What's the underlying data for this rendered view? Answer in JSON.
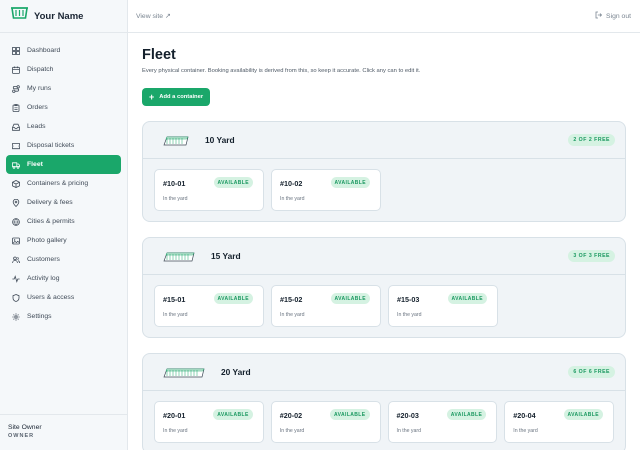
{
  "brand": {
    "name": "Your Name"
  },
  "topbar": {
    "view_site": "View site ↗",
    "sign_out": "Sign out"
  },
  "sidebar": {
    "items": [
      {
        "label": "Dashboard",
        "icon": "dashboard-icon"
      },
      {
        "label": "Dispatch",
        "icon": "calendar-icon"
      },
      {
        "label": "My runs",
        "icon": "route-icon"
      },
      {
        "label": "Orders",
        "icon": "clipboard-icon"
      },
      {
        "label": "Leads",
        "icon": "inbox-icon"
      },
      {
        "label": "Disposal tickets",
        "icon": "ticket-icon"
      },
      {
        "label": "Fleet",
        "icon": "truck-icon",
        "active": true
      },
      {
        "label": "Containers & pricing",
        "icon": "box-icon"
      },
      {
        "label": "Delivery & fees",
        "icon": "map-pin-icon"
      },
      {
        "label": "Cities & permits",
        "icon": "globe-icon"
      },
      {
        "label": "Photo gallery",
        "icon": "image-icon"
      },
      {
        "label": "Customers",
        "icon": "users-icon"
      },
      {
        "label": "Activity log",
        "icon": "activity-icon"
      },
      {
        "label": "Users & access",
        "icon": "shield-icon"
      },
      {
        "label": "Settings",
        "icon": "gear-icon"
      }
    ],
    "footer": {
      "name": "Site Owner",
      "role": "OWNER"
    }
  },
  "page": {
    "title": "Fleet",
    "subtitle": "Every physical container. Booking availability is derived from this, so keep it accurate. Click any can to edit it.",
    "add_button": "Add a container"
  },
  "groups": [
    {
      "title": "10 Yard",
      "free": "2 OF 2 FREE",
      "containers": [
        {
          "id": "#10-01",
          "status": "AVAILABLE",
          "location": "In the yard"
        },
        {
          "id": "#10-02",
          "status": "AVAILABLE",
          "location": "In the yard"
        }
      ]
    },
    {
      "title": "15 Yard",
      "free": "3 OF 3 FREE",
      "containers": [
        {
          "id": "#15-01",
          "status": "AVAILABLE",
          "location": "In the yard"
        },
        {
          "id": "#15-02",
          "status": "AVAILABLE",
          "location": "In the yard"
        },
        {
          "id": "#15-03",
          "status": "AVAILABLE",
          "location": "In the yard"
        }
      ]
    },
    {
      "title": "20 Yard",
      "free": "6 OF 6 FREE",
      "containers": [
        {
          "id": "#20-01",
          "status": "AVAILABLE",
          "location": "In the yard"
        },
        {
          "id": "#20-02",
          "status": "AVAILABLE",
          "location": "In the yard"
        },
        {
          "id": "#20-03",
          "status": "AVAILABLE",
          "location": "In the yard"
        },
        {
          "id": "#20-04",
          "status": "AVAILABLE",
          "location": "In the yard"
        }
      ]
    }
  ],
  "colors": {
    "accent": "#1aa76a",
    "badge_bg": "#d5f2e2",
    "badge_text": "#19985f"
  }
}
